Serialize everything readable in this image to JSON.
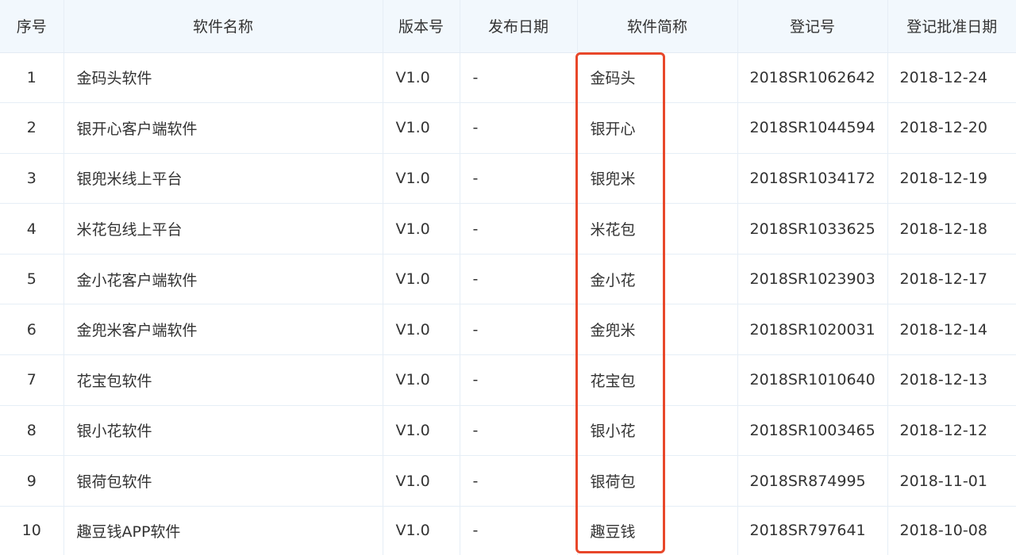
{
  "table": {
    "headers": [
      "序号",
      "软件名称",
      "版本号",
      "发布日期",
      "软件简称",
      "登记号",
      "登记批准日期"
    ],
    "rows": [
      {
        "no": "1",
        "name": "金码头软件",
        "version": "V1.0",
        "release_date": "-",
        "short_name": "金码头",
        "reg_no": "2018SR1062642",
        "approval_date": "2018-12-24"
      },
      {
        "no": "2",
        "name": "银开心客户端软件",
        "version": "V1.0",
        "release_date": "-",
        "short_name": "银开心",
        "reg_no": "2018SR1044594",
        "approval_date": "2018-12-20"
      },
      {
        "no": "3",
        "name": "银兜米线上平台",
        "version": "V1.0",
        "release_date": "-",
        "short_name": "银兜米",
        "reg_no": "2018SR1034172",
        "approval_date": "2018-12-19"
      },
      {
        "no": "4",
        "name": "米花包线上平台",
        "version": "V1.0",
        "release_date": "-",
        "short_name": "米花包",
        "reg_no": "2018SR1033625",
        "approval_date": "2018-12-18"
      },
      {
        "no": "5",
        "name": "金小花客户端软件",
        "version": "V1.0",
        "release_date": "-",
        "short_name": "金小花",
        "reg_no": "2018SR1023903",
        "approval_date": "2018-12-17"
      },
      {
        "no": "6",
        "name": "金兜米客户端软件",
        "version": "V1.0",
        "release_date": "-",
        "short_name": "金兜米",
        "reg_no": "2018SR1020031",
        "approval_date": "2018-12-14"
      },
      {
        "no": "7",
        "name": "花宝包软件",
        "version": "V1.0",
        "release_date": "-",
        "short_name": "花宝包",
        "reg_no": "2018SR1010640",
        "approval_date": "2018-12-13"
      },
      {
        "no": "8",
        "name": "银小花软件",
        "version": "V1.0",
        "release_date": "-",
        "short_name": "银小花",
        "reg_no": "2018SR1003465",
        "approval_date": "2018-12-12"
      },
      {
        "no": "9",
        "name": "银荷包软件",
        "version": "V1.0",
        "release_date": "-",
        "short_name": "银荷包",
        "reg_no": "2018SR874995",
        "approval_date": "2018-11-01"
      },
      {
        "no": "10",
        "name": "趣豆钱APP软件",
        "version": "V1.0",
        "release_date": "-",
        "short_name": "趣豆钱",
        "reg_no": "2018SR797641",
        "approval_date": "2018-10-08"
      }
    ]
  },
  "colors": {
    "header_bg": "#f2f8fd",
    "border": "#e6eef6",
    "text": "#333333",
    "highlight": "#e8472a"
  }
}
